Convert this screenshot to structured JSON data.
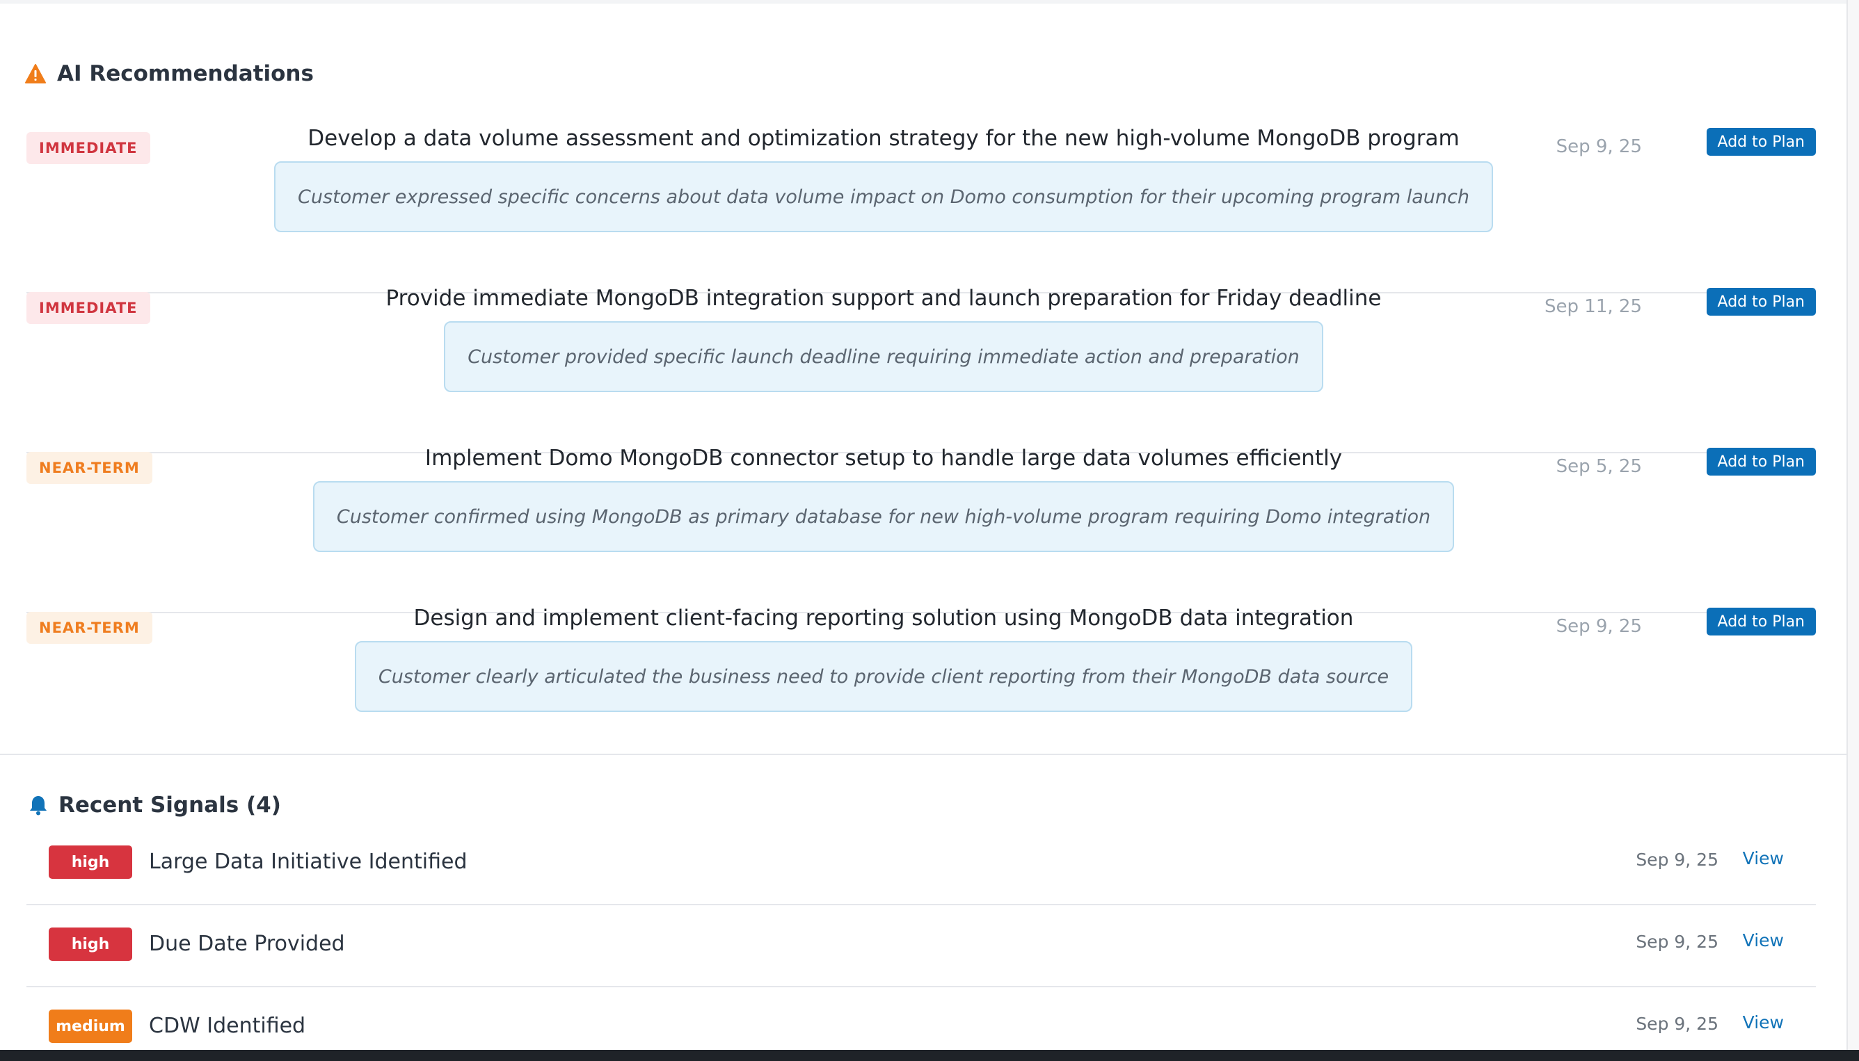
{
  "colors": {
    "immediate_bg": "#fde8ea",
    "immediate_text": "#d0353f",
    "near_term_bg": "#fdf1e4",
    "near_term_text": "#ef7d1f",
    "button_blue": "#0b6fb8",
    "link_blue": "#1173b8",
    "badge_high": "#d7343f",
    "badge_medium": "#f07d1a"
  },
  "ai_recommendations": {
    "title": "AI Recommendations",
    "icon": "warning-icon",
    "items": [
      {
        "priority": "IMMEDIATE",
        "title": "Develop a data volume assessment and optimization strategy for the new high-volume MongoDB program",
        "reason": "Customer expressed specific concerns about data volume impact on Domo consumption for their upcoming program launch",
        "date": "Sep 9, 25",
        "action": "Add to Plan"
      },
      {
        "priority": "IMMEDIATE",
        "title": "Provide immediate MongoDB integration support and launch preparation for Friday deadline",
        "reason": "Customer provided specific launch deadline requiring immediate action and preparation",
        "date": "Sep 11, 25",
        "action": "Add to Plan"
      },
      {
        "priority": "NEAR-TERM",
        "title": "Implement Domo MongoDB connector setup to handle large data volumes efficiently",
        "reason": "Customer confirmed using MongoDB as primary database for new high-volume program requiring Domo integration",
        "date": "Sep 5, 25",
        "action": "Add to Plan"
      },
      {
        "priority": "NEAR-TERM",
        "title": "Design and implement client-facing reporting solution using MongoDB data integration",
        "reason": "Customer clearly articulated the business need to provide client reporting from their MongoDB data source",
        "date": "Sep 9, 25",
        "action": "Add to Plan"
      }
    ]
  },
  "recent_signals": {
    "title": "Recent Signals (4)",
    "icon": "bell-icon",
    "items": [
      {
        "severity": "high",
        "label": "Large Data Initiative Identified",
        "date": "Sep 9, 25",
        "action": "View"
      },
      {
        "severity": "high",
        "label": "Due Date Provided",
        "date": "Sep 9, 25",
        "action": "View"
      },
      {
        "severity": "medium",
        "label": "CDW Identified",
        "date": "Sep 9, 25",
        "action": "View"
      }
    ]
  }
}
